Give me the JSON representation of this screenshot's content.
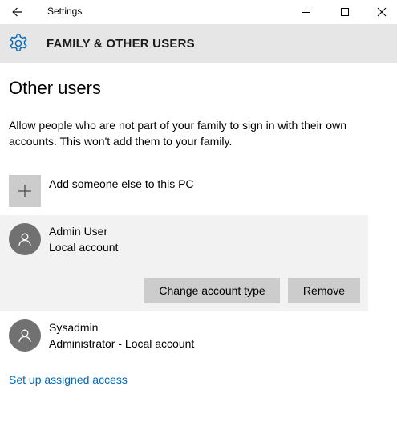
{
  "window": {
    "title": "Settings"
  },
  "header": {
    "title": "FAMILY & OTHER USERS",
    "icon": "gear-icon"
  },
  "main": {
    "section_title": "Other users",
    "description": "Allow people who are not part of your family to sign in with their own accounts. This won't add them to your family.",
    "add_user_label": "Add someone else to this PC",
    "users": [
      {
        "name": "Admin User",
        "account_type": "Local account",
        "selected": true
      },
      {
        "name": "Sysadmin",
        "account_type": "Administrator - Local account",
        "selected": false
      }
    ],
    "change_account_type_label": "Change account type",
    "remove_label": "Remove",
    "assigned_access_link": "Set up assigned access"
  },
  "colors": {
    "accent": "#0067b8",
    "header_bg": "#e6e6e6",
    "selected_bg": "#f2f2f2",
    "button_bg": "#cccccc",
    "avatar_bg": "#717171"
  }
}
